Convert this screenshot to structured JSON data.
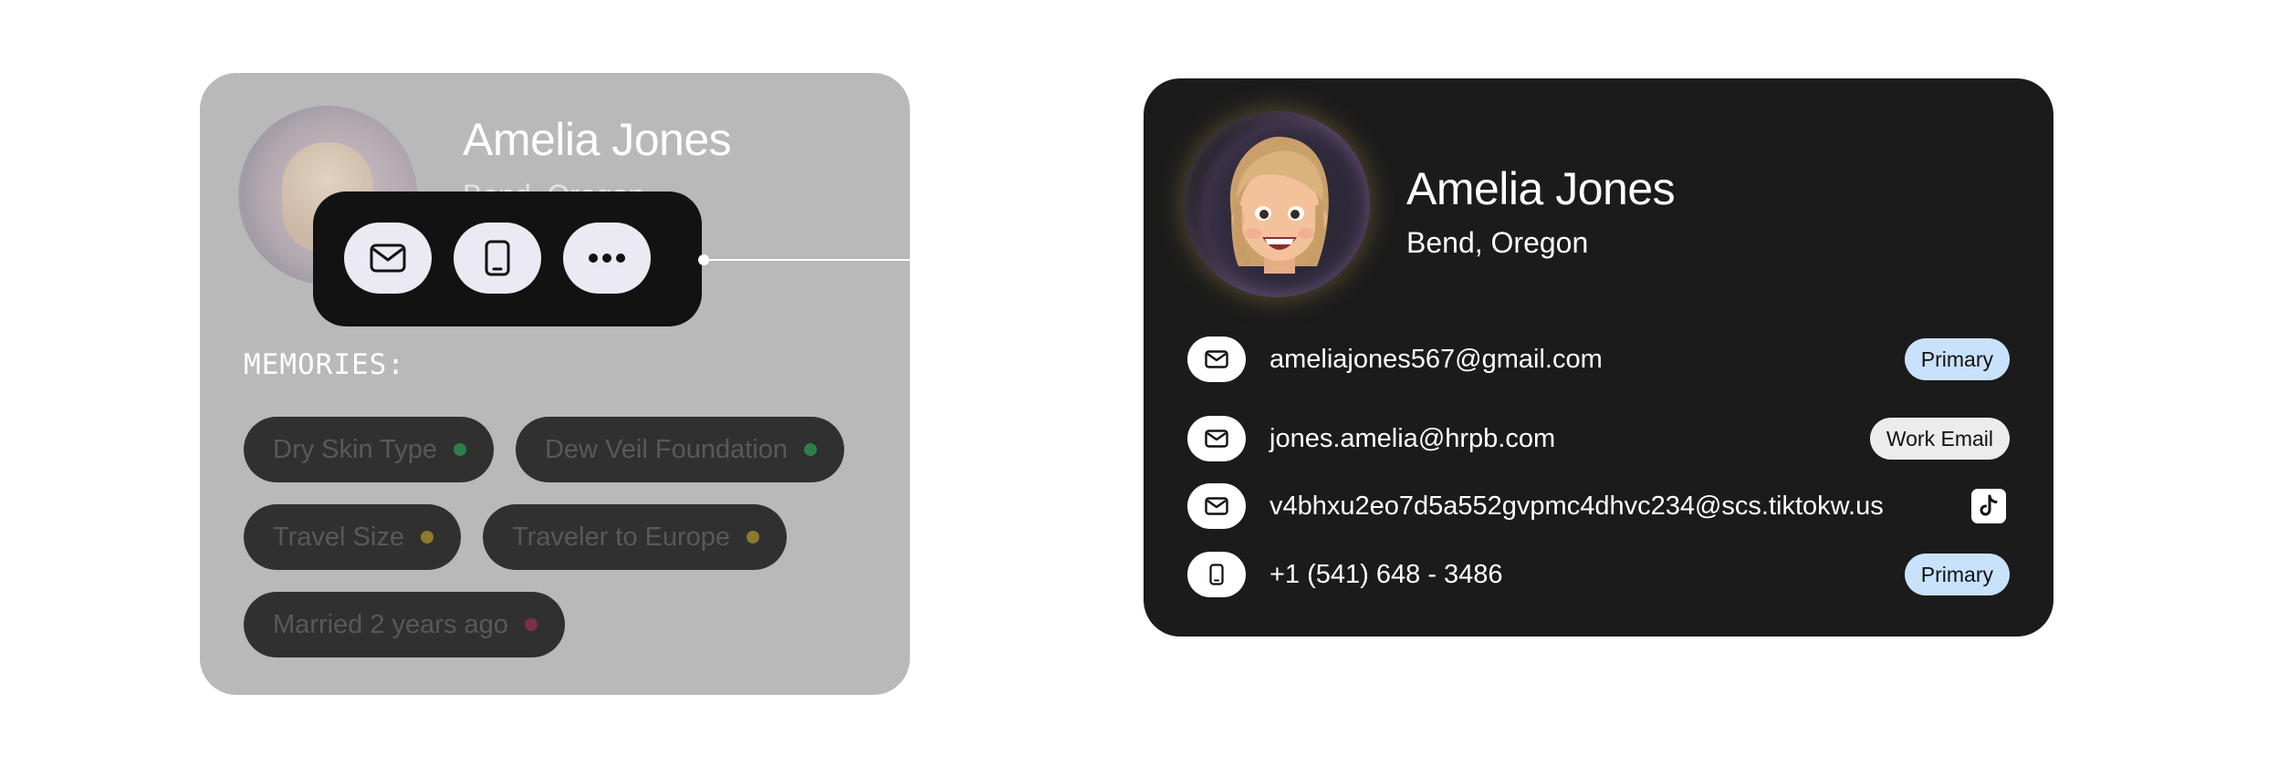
{
  "preview_card": {
    "name": "Amelia Jones",
    "location": "Bend, Oregon",
    "memories_title": "MEMORIES:",
    "memories": [
      {
        "label": "Dry Skin Type",
        "dot_color": "#2e7d4a"
      },
      {
        "label": "Dew Veil Foundation",
        "dot_color": "#2e7d4a"
      },
      {
        "label": "Travel Size",
        "dot_color": "#8c7a2e"
      },
      {
        "label": "Traveler to Europe",
        "dot_color": "#8c7a2e"
      },
      {
        "label": "Married 2 years ago",
        "dot_color": "#7a2e4a"
      }
    ]
  },
  "action_bar": {
    "buttons": [
      {
        "icon": "mail-icon"
      },
      {
        "icon": "phone-icon"
      },
      {
        "icon": "more-icon"
      }
    ]
  },
  "contact_card": {
    "name": "Amelia Jones",
    "location": "Bend, Oregon",
    "entries": [
      {
        "icon": "mail-icon",
        "value": "ameliajones567@gmail.com",
        "badge": "Primary"
      },
      {
        "icon": "mail-icon",
        "value": "jones.amelia@hrpb.com",
        "badge": "Work Email"
      },
      {
        "icon": "mail-icon",
        "value": "v4bhxu2eo7d5a552gvpmc4dhvc234@scs.tiktokw.us",
        "source_icon": "tiktok-icon"
      },
      {
        "icon": "phone-icon",
        "value": "+1 (541) 648 - 3486",
        "badge": "Primary"
      }
    ]
  },
  "colors": {
    "card_dark": "#1b1b1b",
    "card_dimmed": "#b9b9b9",
    "badge_primary": "#c9e2fb",
    "badge_work": "#ececec"
  }
}
